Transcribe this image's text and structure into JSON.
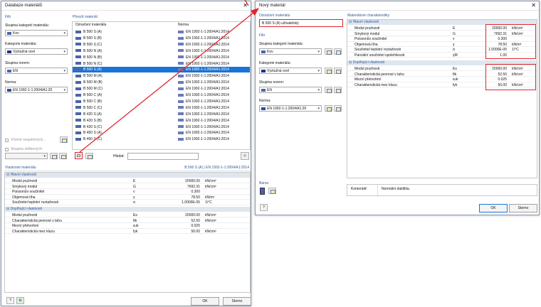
{
  "db_window": {
    "title": "Databáze materiálů",
    "filter_group": "Filtr",
    "cat_group_label": "Skupina kategorií materiálu:",
    "cat_group_value": "Kov",
    "cat_label": "Kategorie materiálu:",
    "cat_value": "Výztužná ocel",
    "norm_group_label": "Skupina norem:",
    "norm_group_value": "EN",
    "norm_label": "Norma:",
    "norm_value": "EN 1992-1-1:2004/A1:20",
    "chk_unreliable": "Včetně nespletrných...",
    "chk_favorites": "Skupina oblíbených:",
    "materials_group": "Převzít materiál",
    "col_name": "Označení materiálu",
    "col_norm": "Norma",
    "materials": [
      {
        "name": "B 500 S (A)",
        "norm": "EN 1992-1-1:2004/A1:2014"
      },
      {
        "name": "B 500 S (B)",
        "norm": "EN 1992-1-1:2004/A1:2014"
      },
      {
        "name": "B 500 S (C)",
        "norm": "EN 1992-1-1:2004/A1:2014"
      },
      {
        "name": "B 500 N (A)",
        "norm": "EN 1992-1-1:2004/A1:2014"
      },
      {
        "name": "B 500 N (B)",
        "norm": "EN 1992-1-1:2004/A1:2014"
      },
      {
        "name": "B 500 N (C)",
        "norm": "EN 1992-1-1:2004/A1:2014"
      },
      {
        "name": "B 500 S (A)",
        "norm": "EN 1992-1-1:2004/A1:2014"
      },
      {
        "name": "B 500 M (A)",
        "norm": "EN 1992-1-1:2004/A1:2014"
      },
      {
        "name": "B 500 M (B)",
        "norm": "EN 1992-1-1:2004/A1:2014"
      },
      {
        "name": "B 500 M (C)",
        "norm": "EN 1992-1-1:2004/A1:2014"
      },
      {
        "name": "B 500 C (A)",
        "norm": "EN 1992-1-1:2004/A1:2014"
      },
      {
        "name": "B 500 C (B)",
        "norm": "EN 1992-1-1:2004/A1:2014"
      },
      {
        "name": "B 500 C (C)",
        "norm": "EN 1992-1-1:2004/A1:2014"
      },
      {
        "name": "B 420 S (A)",
        "norm": "EN 1992-1-1:2004/A1:2014"
      },
      {
        "name": "B 420 S (B)",
        "norm": "EN 1992-1-1:2004/A1:2014"
      },
      {
        "name": "B 420 S (C)",
        "norm": "EN 1992-1-1:2004/A1:2014"
      },
      {
        "name": "B 450 S (A)",
        "norm": "EN 1992-1-1:2004/A1:2014"
      },
      {
        "name": "B 450 S (C)",
        "norm": "EN 1992-1-1:2004/A1:2014"
      }
    ],
    "search_label": "Hledat:",
    "props_title": "Vlastnosti materiálu",
    "props_subtitle": "B 500 S (A) | EN 1992-1-1:2004/A1:2014",
    "ok": "OK",
    "cancel": "Storno"
  },
  "main_props_header": "Hlavní vlastnosti",
  "extra_props_header": "Doplňující vlastnosti",
  "main_props": [
    {
      "name": "Modul pružnosti",
      "sym": "E",
      "val": "20000.00",
      "unit": "kN/cm²"
    },
    {
      "name": "Smykový modul",
      "sym": "G",
      "val": "7692.31",
      "unit": "kN/cm²"
    },
    {
      "name": "Poissonův součinitel",
      "sym": "ν",
      "val": "0.300",
      "unit": ""
    },
    {
      "name": "Objemová tíha",
      "sym": "γ",
      "val": "78.50",
      "unit": "kN/m³"
    },
    {
      "name": "Součinitel teplotní roztažnosti",
      "sym": "α",
      "val": "1.0000E-05",
      "unit": "1/°C"
    }
  ],
  "main_props_new_extra": {
    "name": "Parciální součinitel spolehlivosti",
    "sym": "γM",
    "val": "1.00",
    "unit": ""
  },
  "extra_props": [
    {
      "name": "Modul pružnosti",
      "sym": "Es",
      "val": "20000.00",
      "unit": "kN/cm²"
    },
    {
      "name": "Charakteristická pevnost v tahu",
      "sym": "ftk",
      "val": "52.50",
      "unit": "kN/cm²"
    },
    {
      "name": "Mezní přetvoření",
      "sym": "εuk",
      "val": "0.025",
      "unit": ""
    },
    {
      "name": "Charakteristická mez kluzu",
      "sym": "fyk",
      "val": "50.00",
      "unit": "kN/cm²"
    }
  ],
  "new_window": {
    "title": "Nový materiál",
    "name_group": "Označení materiálu",
    "name_value": "B 500 S (A) uživatelský",
    "filter_group": "Filtr",
    "cat_group_label": "Skupina kategorií materiálu:",
    "cat_group_value": "Kov",
    "cat_label": "Kategorie materiálu:",
    "cat_value": "Výztužná ocel",
    "norm_group_label": "Skupina norem:",
    "norm_group_value": "EN",
    "norm_label": "Norma:",
    "norm_value": "EN 1992-1-1:2004/A1:20",
    "props_group": "Materiálové charakteristiky",
    "color_group": "Barva",
    "comment_label": "Komentář:",
    "comment_value": "Normální duktilita.",
    "ok": "OK",
    "cancel": "Storno"
  },
  "colors": {
    "accent": "#1a73d6",
    "highlight": "#e0262d",
    "group_title": "#2d5a9a"
  }
}
